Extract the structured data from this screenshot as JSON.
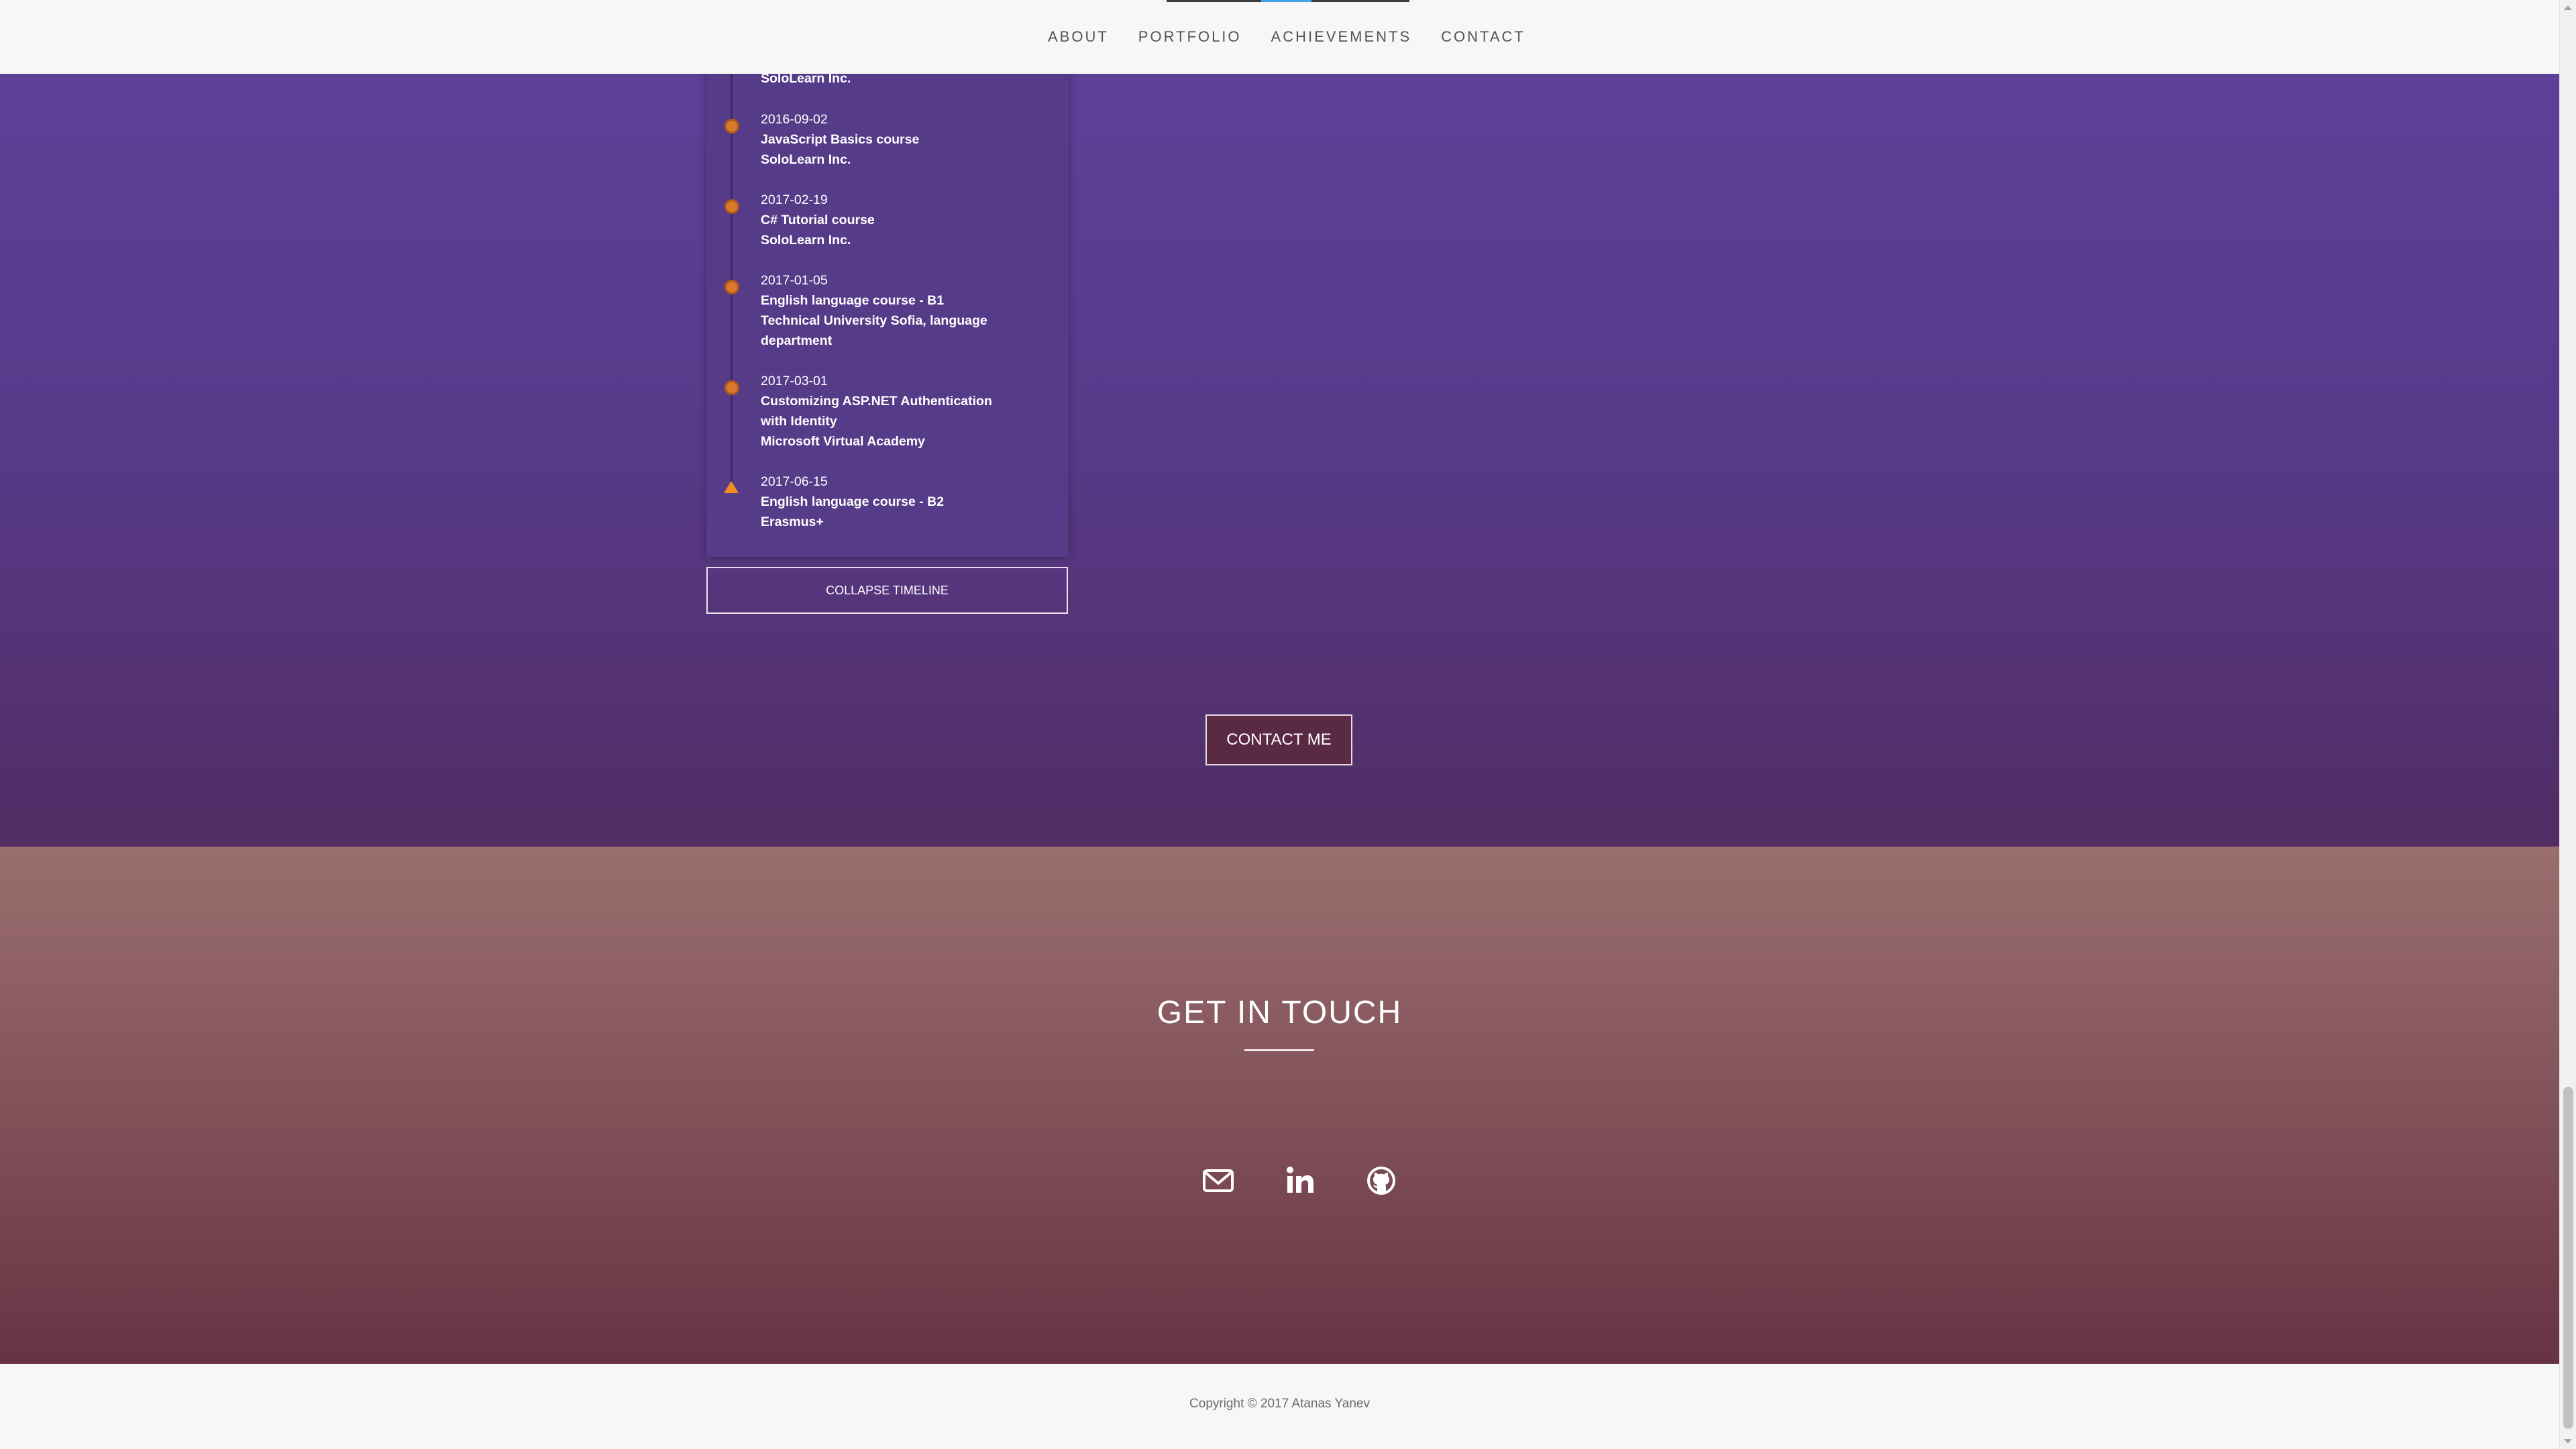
{
  "nav": {
    "items": [
      {
        "label": "ABOUT"
      },
      {
        "label": "PORTFOLIO"
      },
      {
        "label": "ACHIEVEMENTS"
      },
      {
        "label": "CONTACT"
      }
    ]
  },
  "timeline": {
    "items": [
      {
        "date": "",
        "lines": [
          "SoloLearn Inc."
        ]
      },
      {
        "date": "2016-09-02",
        "lines": [
          "JavaScript Basics course",
          "SoloLearn Inc."
        ]
      },
      {
        "date": "2017-02-19",
        "lines": [
          "C# Tutorial course",
          "SoloLearn Inc."
        ]
      },
      {
        "date": "2017-01-05",
        "lines": [
          "English language course - B1",
          "Technical University Sofia, language",
          "department"
        ]
      },
      {
        "date": "2017-03-01",
        "lines": [
          "Customizing ASP.NET Authentication",
          "with Identity",
          "Microsoft Virtual Academy"
        ]
      },
      {
        "date": "2017-06-15",
        "lines": [
          "English language course - B2",
          "Erasmus+"
        ]
      }
    ],
    "collapse_label": "COLLAPSE TIMELINE"
  },
  "cta": {
    "contact_me_label": "CONTACT ME"
  },
  "touch": {
    "title": "GET IN TOUCH",
    "icons": [
      "envelope-icon",
      "linkedin-icon",
      "github-icon"
    ]
  },
  "footer": {
    "copyright": "Copyright © 2017 Atanas Yanev"
  },
  "colors": {
    "purple_top": "#5e419b",
    "purple_bottom": "#512d64",
    "touch_top": "#9a6e6e",
    "touch_bottom": "#663343",
    "timeline_dot": "#d97a2c",
    "nav_active": "#3fa7e8"
  }
}
